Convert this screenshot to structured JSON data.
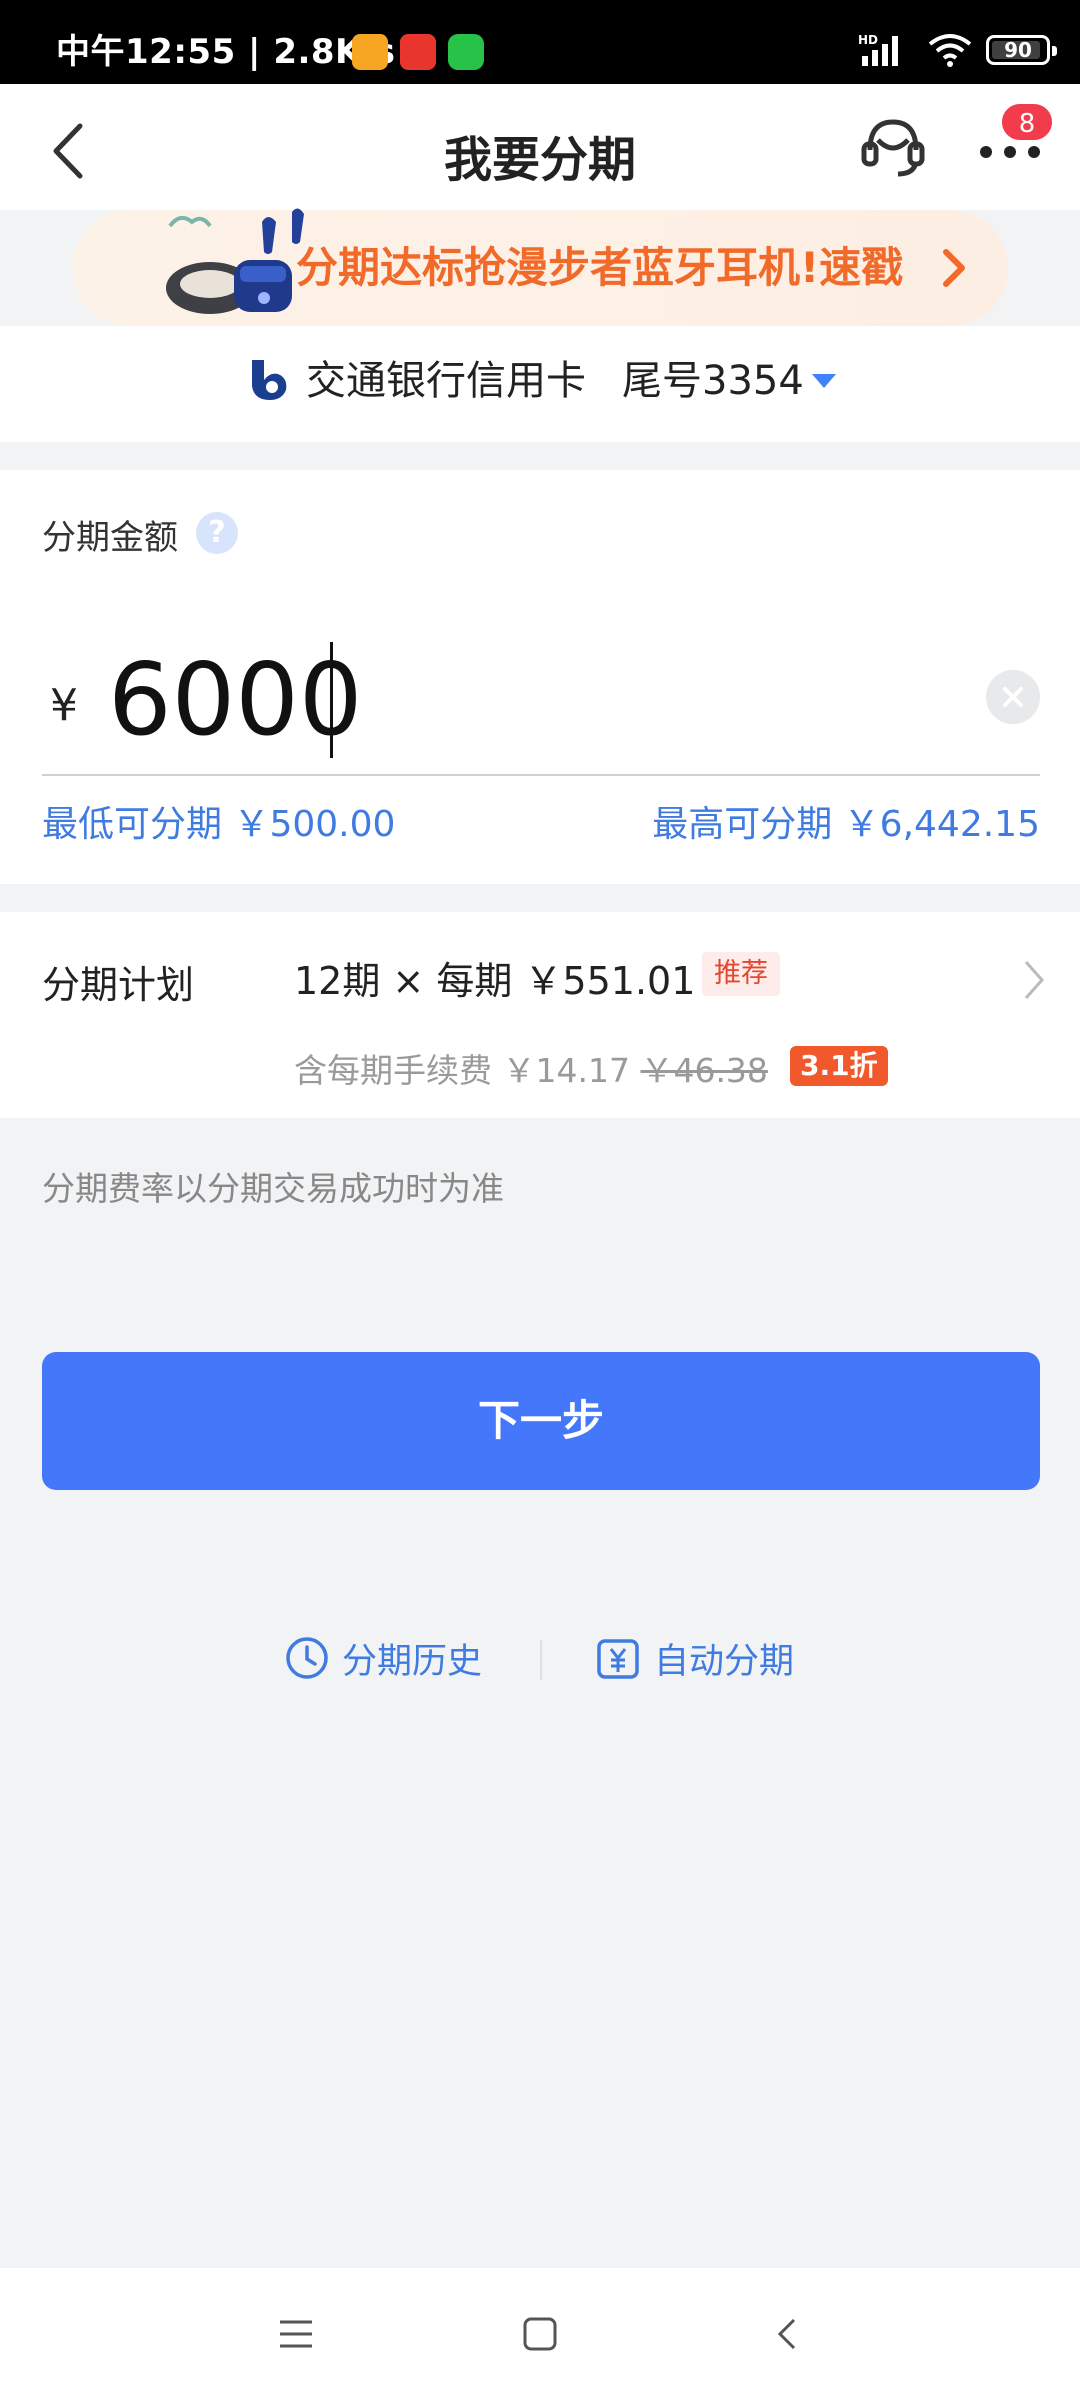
{
  "status_bar": {
    "time": "中午12:55 | 2.8K/s",
    "battery": "90",
    "signal_label": "HD"
  },
  "nav": {
    "title": "我要分期",
    "badge_count": "8"
  },
  "banner": {
    "text": "分期达标抢漫步者蓝牙耳机!速戳"
  },
  "card": {
    "bank_name": "交通银行信用卡",
    "tail": "尾号3354"
  },
  "amount": {
    "label": "分期金额",
    "help_icon": "?",
    "currency": "¥",
    "value": "6000",
    "min_label": "最低可分期 ￥500.00",
    "max_label": "最高可分期 ￥6,442.15"
  },
  "plan": {
    "label": "分期计划",
    "detail": "12期 × 每期 ￥551.01",
    "tag": "推荐",
    "fee_prefix": "含每期手续费 ￥14.17 ",
    "fee_original": "￥46.38",
    "discount": "3.1折"
  },
  "note": "分期费率以分期交易成功时为准",
  "next_button": "下一步",
  "footer": {
    "history": "分期历史",
    "auto": "自动分期"
  },
  "colors": {
    "accent": "#4477fa",
    "link": "#3f7be0",
    "banner_text": "#f26a2a",
    "discount": "#f1582c"
  }
}
